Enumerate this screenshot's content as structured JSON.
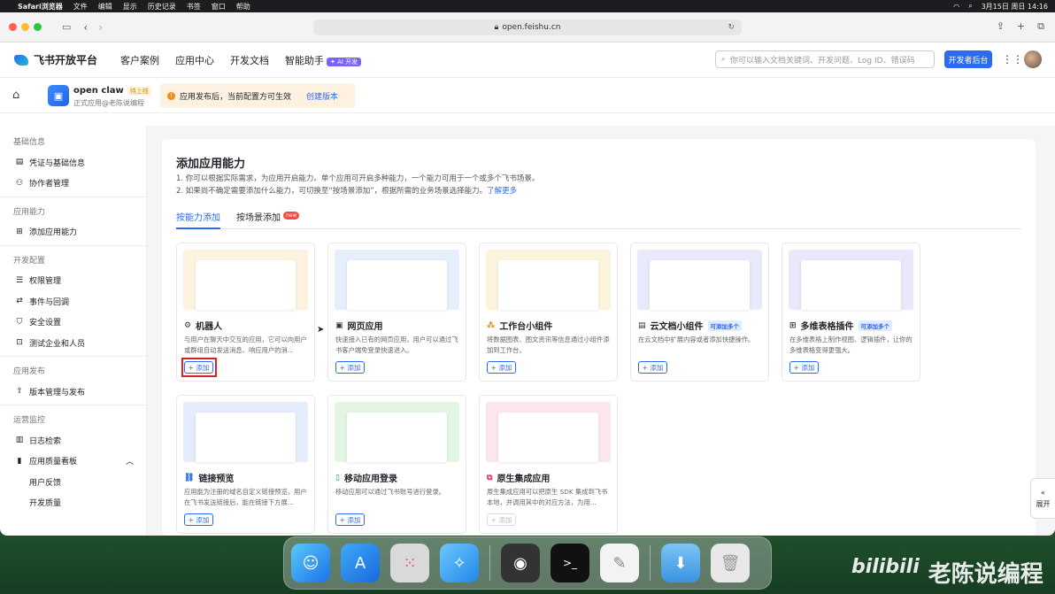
{
  "menubar": {
    "apple": "",
    "app": "Safari浏览器",
    "items": [
      "文件",
      "编辑",
      "显示",
      "历史记录",
      "书签",
      "窗口",
      "帮助"
    ],
    "datetime": "3月15日 周日  14:16"
  },
  "browser": {
    "url": "open.feishu.cn"
  },
  "topnav": {
    "brand": "飞书开放平台",
    "items": [
      "客户案例",
      "应用中心",
      "开发文档",
      "智能助手"
    ],
    "ai_badge": "✦ AI 开发",
    "search_placeholder": "你可以输入文档关键词、开发问题、Log ID、错误码",
    "dev_button": "开发者后台"
  },
  "app": {
    "name": "open claw",
    "status": "待上线",
    "subtitle": "正式应用@老陈说编程",
    "notice": "应用发布后，当前配置方可生效",
    "create_version": "创建版本"
  },
  "sidebar": {
    "sections": [
      {
        "title": "基础信息",
        "items": [
          "凭证与基础信息",
          "协作者管理"
        ]
      },
      {
        "title": "应用能力",
        "items": [
          "添加应用能力"
        ]
      },
      {
        "title": "开发配置",
        "items": [
          "权限管理",
          "事件与回调",
          "安全设置",
          "测试企业和人员"
        ]
      },
      {
        "title": "应用发布",
        "items": [
          "版本管理与发布"
        ]
      },
      {
        "title": "运营监控",
        "items": [
          "日志检索",
          "应用质量看板"
        ],
        "subitems": [
          "用户反馈",
          "开发质量"
        ]
      }
    ]
  },
  "panel": {
    "title": "添加应用能力",
    "desc1": "1. 你可以根据实际需求，为应用开启能力。单个应用可开启多种能力，一个能力可用于一个或多个飞书场景。",
    "desc2": "2. 如果尚不确定需要添加什么能力，可切换至“按场景添加”，根据所需的业务场景选择能力。",
    "learn_more": "了解更多",
    "tabs": [
      "按能力添加",
      "按场景添加"
    ],
    "new_badge": "new",
    "add_label": "+ 添加",
    "cards": [
      {
        "title": "机器人",
        "tag": "",
        "desc": "与用户在聊天中交互的应用，它可以向用户或群组自动发送消息、响应用户的消...",
        "color": "#fdf1df"
      },
      {
        "title": "网页应用",
        "tag": "",
        "desc": "快速接入已有的网页应用，用户可以通过飞书客户端免登录快速进入。",
        "color": "#e6edfb"
      },
      {
        "title": "工作台小组件",
        "tag": "",
        "desc": "将数据图表、图文资讯等信息通过小组件添加到工作台。",
        "color": "#fcf3dc"
      },
      {
        "title": "云文档小组件",
        "tag": "可添加多个",
        "desc": "在云文档中扩展内容或者添加快捷操作。",
        "color": "#e8e9fa"
      },
      {
        "title": "多维表格插件",
        "tag": "可添加多个",
        "desc": "在多维表格上制作视图、逻辑插件，让你的多维表格变得更强大。",
        "color": "#ece6fb"
      },
      {
        "title": "链接预览",
        "tag": "",
        "desc": "应用能为注册的域名自定义链接预览，用户在飞书发送链接后，能在链接下方展...",
        "color": "#e5ecfb"
      },
      {
        "title": "移动应用登录",
        "tag": "",
        "desc": "移动应用可以通过飞书账号进行登录。",
        "color": "#e3f5e3"
      },
      {
        "title": "原生集成应用",
        "tag": "",
        "desc": "原生集成应用可以把原生 SDK 集成到飞书本地，并调用其中的对应方法，为用...",
        "color": "#fbe6ee"
      }
    ]
  },
  "expand": "展开",
  "watermark": {
    "logo": "bilibili",
    "text": "老陈说编程"
  }
}
